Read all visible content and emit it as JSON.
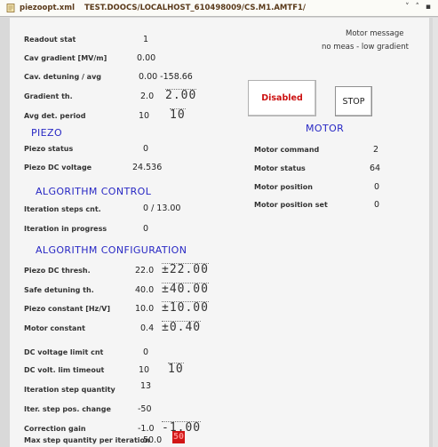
{
  "window": {
    "file": "piezoopt.xml",
    "path": "TEST.DOOCS/LOCALHOST_610498009/CS.M1.AMTF1/",
    "chevrons": "˅ ˄ ▪"
  },
  "top": [
    {
      "label": "Readout stat",
      "value": "1"
    },
    {
      "label": "Cav gradient [MV/m]",
      "value": "0.00"
    },
    {
      "label": "Cav. detuning / avg",
      "value": "0.00  -158.66"
    },
    {
      "label": "Gradient th.",
      "value": "2.0",
      "spin": "2.00"
    },
    {
      "label": "Avg det. period",
      "value": "10",
      "spin": "10"
    }
  ],
  "piezo": {
    "title": "PIEZO",
    "rows": [
      {
        "label": "Piezo status",
        "value": "0"
      },
      {
        "label": "Piezo DC voltage",
        "value": "24.536"
      }
    ]
  },
  "algorithm_control": {
    "title": "ALGORITHM CONTROL",
    "rows": [
      {
        "label": "Iteration steps cnt.",
        "value": "0  /  13.00"
      },
      {
        "label": "Iteration in progress",
        "value": "0"
      }
    ]
  },
  "algorithm_configuration": {
    "title": "ALGORITHM CONFIGURATION",
    "rows": [
      {
        "label": "Piezo DC thresh.",
        "value": "22.0",
        "spin": "±22.00"
      },
      {
        "label": "Safe detuning th.",
        "value": "40.0",
        "spin": "±40.00"
      },
      {
        "label": "Piezo constant [Hz/V]",
        "value": "10.0",
        "spin": "±10.00"
      },
      {
        "label": "Motor constant",
        "value": "0.4",
        "spin": "±0.40"
      },
      {
        "label": "DC voltage limit cnt",
        "value": "0"
      },
      {
        "label": "DC volt. lim timeout",
        "value": "10",
        "spin": "10"
      },
      {
        "label": "Iteration step quantity",
        "value": "13"
      },
      {
        "label": "Iter. step pos. change",
        "value": "-50"
      },
      {
        "label": "Correction gain",
        "value": "-1.0",
        "spin": "-1.00"
      },
      {
        "label": "Max step quantity per iteration",
        "value": "50.0",
        "spin": "50"
      }
    ]
  },
  "motor_message": {
    "title": "Motor message",
    "text": "no meas - low gradient"
  },
  "buttons": {
    "disabled": "Disabled",
    "stop": "STOP"
  },
  "motor": {
    "title": "MOTOR",
    "rows": [
      {
        "label": "Motor command",
        "value": "2"
      },
      {
        "label": "Motor status",
        "value": "64"
      },
      {
        "label": "Motor position",
        "value": "0"
      },
      {
        "label": "Motor position set",
        "value": "0"
      }
    ]
  },
  "colors": {
    "section_title": "#2828c4",
    "disabled_text": "#cc1111",
    "alarm_field": "#d11515",
    "panel_bg": "#f5f5f5",
    "frame_bg": "#d9d9d9"
  }
}
